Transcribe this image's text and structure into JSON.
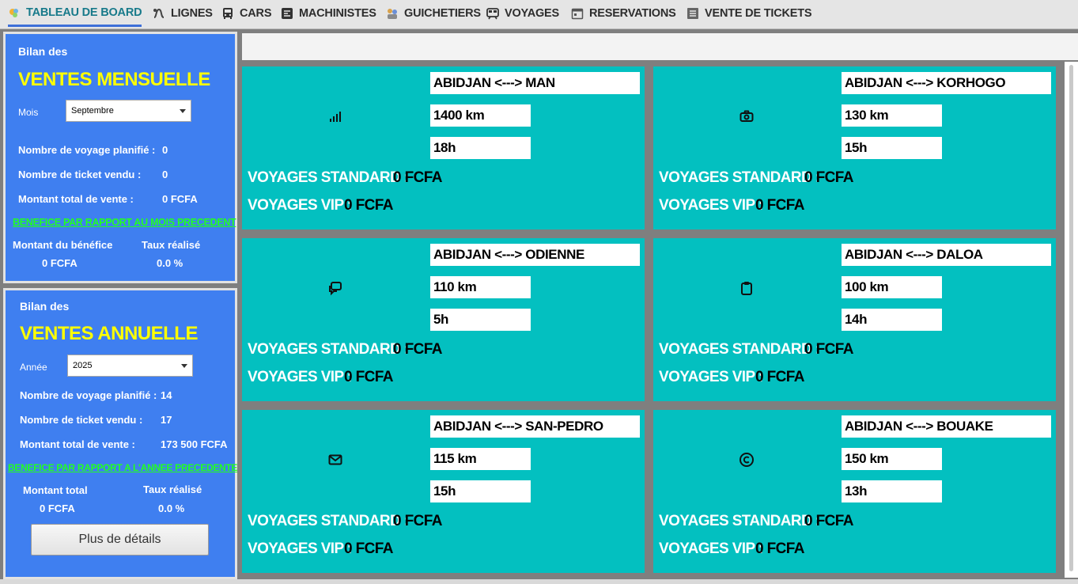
{
  "nav": [
    {
      "label": "TABLEAU DE BOARD",
      "icon": "dashboard-icon",
      "active": true
    },
    {
      "label": "LIGNES",
      "icon": "route-icon"
    },
    {
      "label": "CARS",
      "icon": "bus-icon"
    },
    {
      "label": "MACHINISTES",
      "icon": "driver-icon"
    },
    {
      "label": "GUICHETIERS",
      "icon": "staff-icon"
    },
    {
      "label": "VOYAGES",
      "icon": "train-icon"
    },
    {
      "label": "RESERVATIONS",
      "icon": "calendar-icon"
    },
    {
      "label": "VENTE DE TICKETS",
      "icon": "ticket-list-icon"
    }
  ],
  "monthly": {
    "heading_small": "Bilan des",
    "heading_big": "VENTES MENSUELLE",
    "select_label": "Mois",
    "select_value": "Septembre",
    "rows": [
      {
        "label": "Nombre de voyage planifié :",
        "value": "0"
      },
      {
        "label": "Nombre de ticket vendu :",
        "value": "0"
      },
      {
        "label": "Montant total de vente :",
        "value": "0 FCFA"
      }
    ],
    "benefit_title": "BENEFICE PAR RAPPORT AU MOIS PRECEDENT",
    "benefit_amount_label": "Montant du bénéfice",
    "benefit_amount_value": "0 FCFA",
    "rate_label": "Taux réalisé",
    "rate_value": "0.0 %"
  },
  "yearly": {
    "heading_small": "Bilan des",
    "heading_big": "VENTES ANNUELLE",
    "select_label": "Année",
    "select_value": "2025",
    "rows": [
      {
        "label": "Nombre de voyage planifié :",
        "value": "14"
      },
      {
        "label": "Nombre de ticket vendu :",
        "value": "17"
      },
      {
        "label": "Montant total de vente :",
        "value": "173 500 FCFA"
      }
    ],
    "benefit_title": "BENEFICE PAR RAPPORT A L'ANNEE PRECEDENTE",
    "benefit_amount_label": "Montant total",
    "benefit_amount_value": "0 FCFA",
    "rate_label": "Taux réalisé",
    "rate_value": "0.0 %",
    "details_button": "Plus de détails"
  },
  "cards": [
    {
      "route": "ABIDJAN <---> MAN",
      "distance": "1400 km",
      "duration": "18h",
      "icon": "signal-bars-icon",
      "standard_label": "VOYAGES STANDARD :",
      "standard_value": "0 FCFA",
      "vip_label": "VOYAGES VIP :",
      "vip_value": "0 FCFA"
    },
    {
      "route": "ABIDJAN <---> KORHOGO",
      "distance": "130 km",
      "duration": "15h",
      "icon": "camera-icon",
      "standard_label": "VOYAGES STANDARD :",
      "standard_value": "0 FCFA",
      "vip_label": "VOYAGES VIP :",
      "vip_value": "0 FCFA"
    },
    {
      "route": "ABIDJAN <---> ODIENNE",
      "distance": "110 km",
      "duration": "5h",
      "icon": "chat-icon",
      "standard_label": "VOYAGES STANDARD :",
      "standard_value": "0 FCFA",
      "vip_label": "VOYAGES VIP :",
      "vip_value": "0 FCFA"
    },
    {
      "route": "ABIDJAN <---> DALOA",
      "distance": "100 km",
      "duration": "14h",
      "icon": "clipboard-icon",
      "standard_label": "VOYAGES STANDARD :",
      "standard_value": "0 FCFA",
      "vip_label": "VOYAGES VIP :",
      "vip_value": "0 FCFA"
    },
    {
      "route": "ABIDJAN <---> SAN-PEDRO",
      "distance": "115 km",
      "duration": "15h",
      "icon": "mail-icon",
      "standard_label": "VOYAGES STANDARD :",
      "standard_value": "0 FCFA",
      "vip_label": "VOYAGES VIP :",
      "vip_value": "0 FCFA"
    },
    {
      "route": "ABIDJAN <---> BOUAKE",
      "distance": "150 km",
      "duration": "13h",
      "icon": "copyright-icon",
      "standard_label": "VOYAGES STANDARD :",
      "standard_value": "0 FCFA",
      "vip_label": "VOYAGES VIP :",
      "vip_value": "0 FCFA"
    }
  ]
}
